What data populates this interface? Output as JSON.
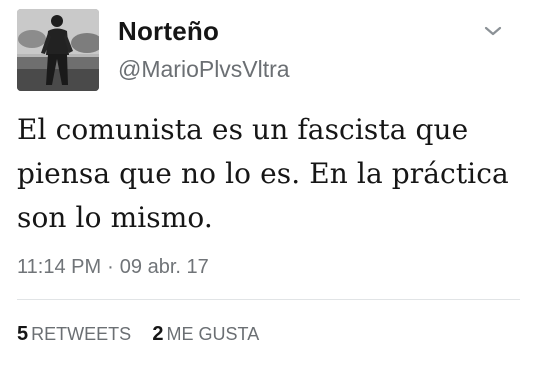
{
  "user": {
    "display_name": "Norteño",
    "handle": "@MarioPlvsVltra",
    "avatar_icon": "profile-photo-person-standing"
  },
  "menu": {
    "icon": "chevron-down-icon"
  },
  "tweet": {
    "text": "El comunista es un fascista que piensa que no lo es. En la práctica son lo mismo.",
    "time": "11:14 PM",
    "separator": "·",
    "date": "09 abr. 17"
  },
  "stats": {
    "retweets_count": "5",
    "retweets_label": "RETWEETS",
    "likes_count": "2",
    "likes_label": "ME GUSTA"
  },
  "colors": {
    "name": "#151515",
    "secondary_text": "#6b6f73",
    "divider": "#e1e4e6",
    "background": "#ffffff"
  }
}
